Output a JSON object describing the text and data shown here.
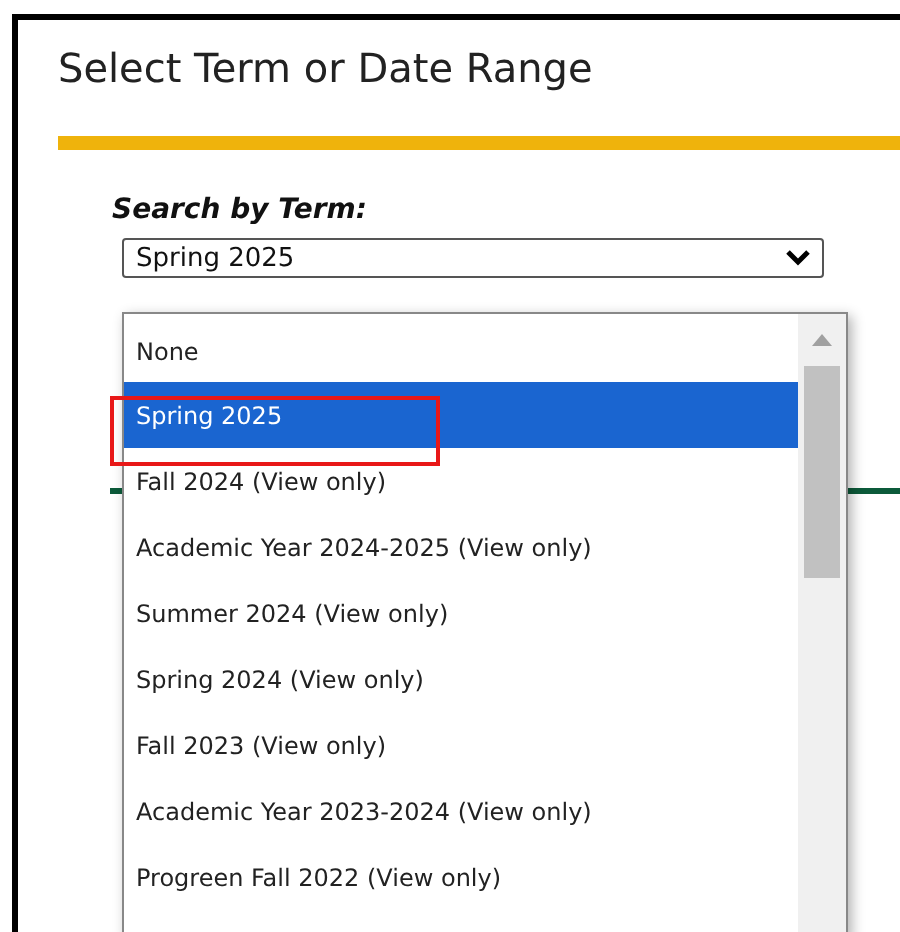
{
  "title": "Select Term or Date Range",
  "search_by_term": {
    "label": "Search by Term:",
    "value": "Spring 2025"
  },
  "dropdown_options": [
    {
      "label": "None",
      "selected": false
    },
    {
      "label": "Spring 2025",
      "selected": true,
      "highlighted": true
    },
    {
      "label": "Fall 2024 (View only)",
      "selected": false
    },
    {
      "label": "Academic Year 2024-2025 (View only)",
      "selected": false
    },
    {
      "label": "Summer 2024 (View only)",
      "selected": false
    },
    {
      "label": "Spring 2024 (View only)",
      "selected": false
    },
    {
      "label": "Fall 2023 (View only)",
      "selected": false
    },
    {
      "label": "Academic Year 2023-2024 (View only)",
      "selected": false
    },
    {
      "label": "Progreen Fall 2022 (View only)",
      "selected": false
    }
  ]
}
